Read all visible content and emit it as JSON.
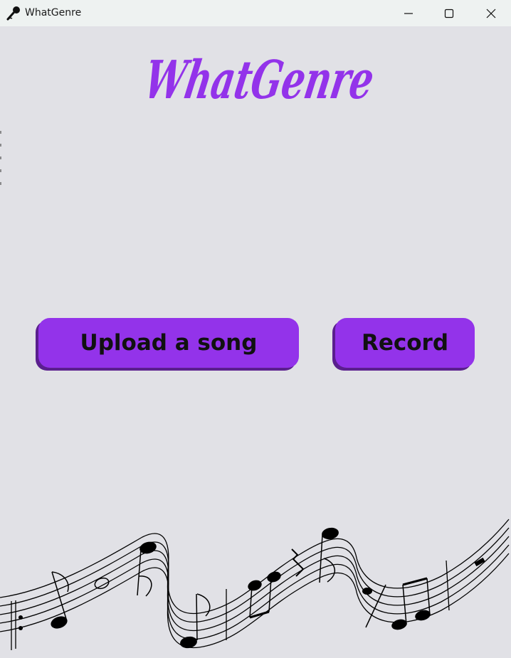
{
  "window": {
    "title": "WhatGenre",
    "icon": "microphone-icon",
    "controls": [
      "minimize-icon",
      "maximize-icon",
      "close-icon"
    ]
  },
  "logo": {
    "text": "WhatGenre",
    "color": "#9333ea"
  },
  "actions": {
    "upload_label": "Upload a song",
    "record_label": "Record"
  },
  "theme": {
    "background": "#e1e1e6",
    "accent": "#9333ea",
    "accent_shadow": "#5a1f8e",
    "titlebar": "#eef2f1"
  },
  "decoration": {
    "icon": "music-staff-icon"
  }
}
